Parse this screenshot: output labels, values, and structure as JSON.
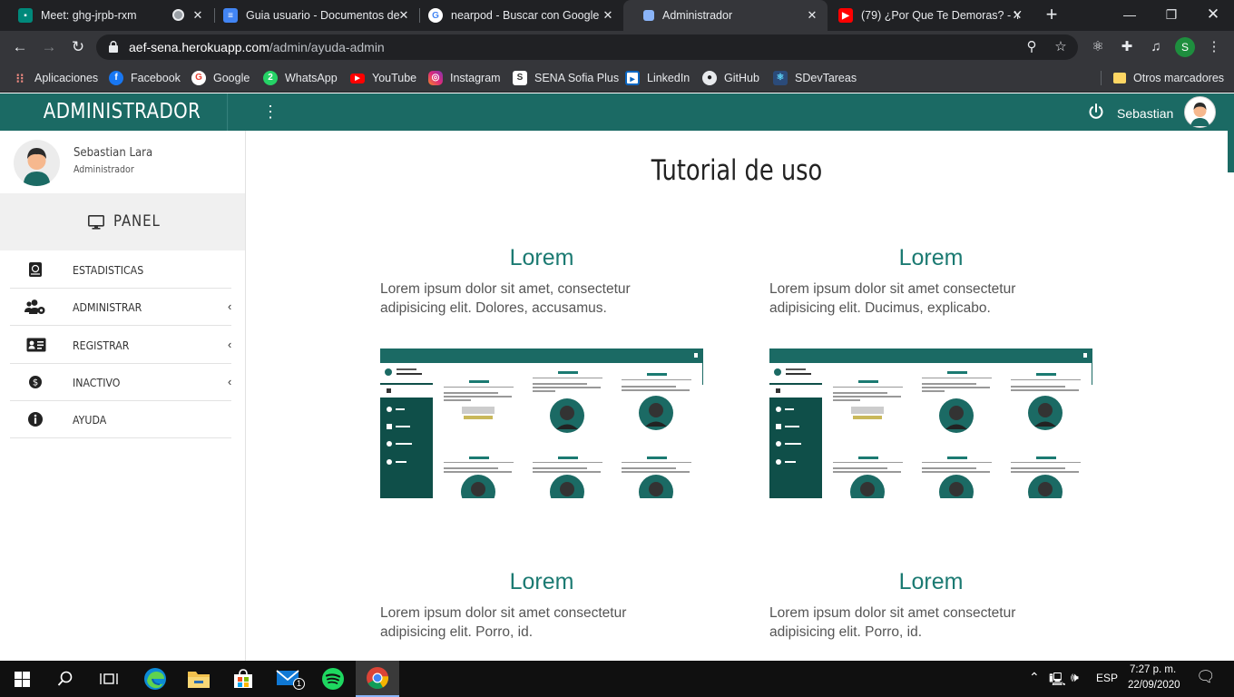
{
  "browser": {
    "tabs": [
      {
        "title": "Meet: ghg-jrpb-rxm",
        "favicon_color": "#00897b"
      },
      {
        "title": "Guia usuario - Documentos de",
        "favicon_color": "#4285f4"
      },
      {
        "title": "nearpod - Buscar con Google",
        "favicon_color": "#ffffff"
      },
      {
        "title": "Administrador",
        "favicon_color": "#8ab4f8"
      },
      {
        "title": "(79) ¿Por Que Te Demoras? - Y",
        "favicon_color": "#ff0000"
      }
    ],
    "url_host": "aef-sena.herokuapp.com",
    "url_path": "/admin/ayuda-admin",
    "profile_initial": "S",
    "bookmarks": [
      {
        "label": "Aplicaciones",
        "icon": "apps-grid-icon"
      },
      {
        "label": "Facebook",
        "icon": "facebook-icon"
      },
      {
        "label": "Google",
        "icon": "google-icon"
      },
      {
        "label": "WhatsApp",
        "icon": "whatsapp-icon"
      },
      {
        "label": "YouTube",
        "icon": "youtube-icon"
      },
      {
        "label": "Instagram",
        "icon": "instagram-icon"
      },
      {
        "label": "SENA Sofia Plus",
        "icon": "sena-icon"
      },
      {
        "label": "LinkedIn",
        "icon": "linkedin-icon"
      },
      {
        "label": "GitHub",
        "icon": "github-icon"
      },
      {
        "label": "SDevTareas",
        "icon": "react-icon"
      }
    ],
    "other_bookmarks": "Otros marcadores"
  },
  "app": {
    "brand": "ADMINISTRADOR",
    "header_user": "Sebastian",
    "profile_name": "Sebastian Lara",
    "profile_role": "Administrador",
    "panel_label": "PANEL",
    "nav": [
      {
        "label": "ESTADISTICAS",
        "icon": "stats-book-icon",
        "has_submenu": false
      },
      {
        "label": "ADMINISTRAR",
        "icon": "users-cog-icon",
        "has_submenu": true
      },
      {
        "label": "REGISTRAR",
        "icon": "id-card-icon",
        "has_submenu": true
      },
      {
        "label": "INACTIVO",
        "icon": "inactive-icon",
        "has_submenu": false
      },
      {
        "label": "AYUDA",
        "icon": "info-icon",
        "has_submenu": false
      }
    ],
    "page_title": "Tutorial de uso",
    "cards": [
      {
        "title": "Lorem",
        "description": "Lorem ipsum dolor sit amet, consectetur adipisicing elit. Dolores, accusamus."
      },
      {
        "title": "Lorem",
        "description": "Lorem ipsum dolor sit amet consectetur adipisicing elit. Ducimus, explicabo."
      },
      {
        "title": "Lorem",
        "description": "Lorem ipsum dolor sit amet consectetur adipisicing elit. Porro, id."
      },
      {
        "title": "Lorem",
        "description": "Lorem ipsum dolor sit amet consectetur adipisicing elit. Porro, id."
      }
    ],
    "accent_color": "#1b6a64"
  },
  "taskbar": {
    "language": "ESP",
    "time": "7:27 p. m.",
    "date": "22/09/2020",
    "mail_badge": "1"
  }
}
